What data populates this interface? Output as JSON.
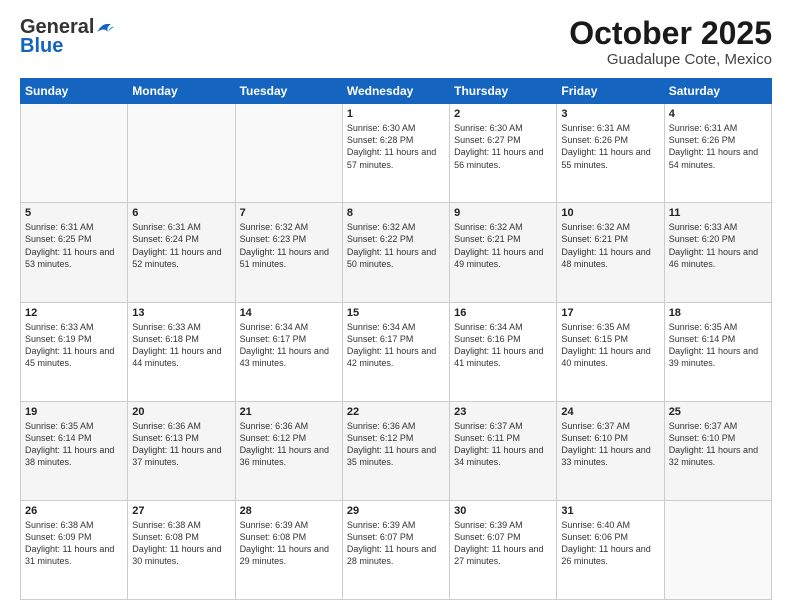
{
  "header": {
    "logo_general": "General",
    "logo_blue": "Blue",
    "title": "October 2025",
    "subtitle": "Guadalupe Cote, Mexico"
  },
  "weekdays": [
    "Sunday",
    "Monday",
    "Tuesday",
    "Wednesday",
    "Thursday",
    "Friday",
    "Saturday"
  ],
  "weeks": [
    [
      {
        "day": "",
        "sunrise": "",
        "sunset": "",
        "daylight": ""
      },
      {
        "day": "",
        "sunrise": "",
        "sunset": "",
        "daylight": ""
      },
      {
        "day": "",
        "sunrise": "",
        "sunset": "",
        "daylight": ""
      },
      {
        "day": "1",
        "sunrise": "Sunrise: 6:30 AM",
        "sunset": "Sunset: 6:28 PM",
        "daylight": "Daylight: 11 hours and 57 minutes."
      },
      {
        "day": "2",
        "sunrise": "Sunrise: 6:30 AM",
        "sunset": "Sunset: 6:27 PM",
        "daylight": "Daylight: 11 hours and 56 minutes."
      },
      {
        "day": "3",
        "sunrise": "Sunrise: 6:31 AM",
        "sunset": "Sunset: 6:26 PM",
        "daylight": "Daylight: 11 hours and 55 minutes."
      },
      {
        "day": "4",
        "sunrise": "Sunrise: 6:31 AM",
        "sunset": "Sunset: 6:26 PM",
        "daylight": "Daylight: 11 hours and 54 minutes."
      }
    ],
    [
      {
        "day": "5",
        "sunrise": "Sunrise: 6:31 AM",
        "sunset": "Sunset: 6:25 PM",
        "daylight": "Daylight: 11 hours and 53 minutes."
      },
      {
        "day": "6",
        "sunrise": "Sunrise: 6:31 AM",
        "sunset": "Sunset: 6:24 PM",
        "daylight": "Daylight: 11 hours and 52 minutes."
      },
      {
        "day": "7",
        "sunrise": "Sunrise: 6:32 AM",
        "sunset": "Sunset: 6:23 PM",
        "daylight": "Daylight: 11 hours and 51 minutes."
      },
      {
        "day": "8",
        "sunrise": "Sunrise: 6:32 AM",
        "sunset": "Sunset: 6:22 PM",
        "daylight": "Daylight: 11 hours and 50 minutes."
      },
      {
        "day": "9",
        "sunrise": "Sunrise: 6:32 AM",
        "sunset": "Sunset: 6:21 PM",
        "daylight": "Daylight: 11 hours and 49 minutes."
      },
      {
        "day": "10",
        "sunrise": "Sunrise: 6:32 AM",
        "sunset": "Sunset: 6:21 PM",
        "daylight": "Daylight: 11 hours and 48 minutes."
      },
      {
        "day": "11",
        "sunrise": "Sunrise: 6:33 AM",
        "sunset": "Sunset: 6:20 PM",
        "daylight": "Daylight: 11 hours and 46 minutes."
      }
    ],
    [
      {
        "day": "12",
        "sunrise": "Sunrise: 6:33 AM",
        "sunset": "Sunset: 6:19 PM",
        "daylight": "Daylight: 11 hours and 45 minutes."
      },
      {
        "day": "13",
        "sunrise": "Sunrise: 6:33 AM",
        "sunset": "Sunset: 6:18 PM",
        "daylight": "Daylight: 11 hours and 44 minutes."
      },
      {
        "day": "14",
        "sunrise": "Sunrise: 6:34 AM",
        "sunset": "Sunset: 6:17 PM",
        "daylight": "Daylight: 11 hours and 43 minutes."
      },
      {
        "day": "15",
        "sunrise": "Sunrise: 6:34 AM",
        "sunset": "Sunset: 6:17 PM",
        "daylight": "Daylight: 11 hours and 42 minutes."
      },
      {
        "day": "16",
        "sunrise": "Sunrise: 6:34 AM",
        "sunset": "Sunset: 6:16 PM",
        "daylight": "Daylight: 11 hours and 41 minutes."
      },
      {
        "day": "17",
        "sunrise": "Sunrise: 6:35 AM",
        "sunset": "Sunset: 6:15 PM",
        "daylight": "Daylight: 11 hours and 40 minutes."
      },
      {
        "day": "18",
        "sunrise": "Sunrise: 6:35 AM",
        "sunset": "Sunset: 6:14 PM",
        "daylight": "Daylight: 11 hours and 39 minutes."
      }
    ],
    [
      {
        "day": "19",
        "sunrise": "Sunrise: 6:35 AM",
        "sunset": "Sunset: 6:14 PM",
        "daylight": "Daylight: 11 hours and 38 minutes."
      },
      {
        "day": "20",
        "sunrise": "Sunrise: 6:36 AM",
        "sunset": "Sunset: 6:13 PM",
        "daylight": "Daylight: 11 hours and 37 minutes."
      },
      {
        "day": "21",
        "sunrise": "Sunrise: 6:36 AM",
        "sunset": "Sunset: 6:12 PM",
        "daylight": "Daylight: 11 hours and 36 minutes."
      },
      {
        "day": "22",
        "sunrise": "Sunrise: 6:36 AM",
        "sunset": "Sunset: 6:12 PM",
        "daylight": "Daylight: 11 hours and 35 minutes."
      },
      {
        "day": "23",
        "sunrise": "Sunrise: 6:37 AM",
        "sunset": "Sunset: 6:11 PM",
        "daylight": "Daylight: 11 hours and 34 minutes."
      },
      {
        "day": "24",
        "sunrise": "Sunrise: 6:37 AM",
        "sunset": "Sunset: 6:10 PM",
        "daylight": "Daylight: 11 hours and 33 minutes."
      },
      {
        "day": "25",
        "sunrise": "Sunrise: 6:37 AM",
        "sunset": "Sunset: 6:10 PM",
        "daylight": "Daylight: 11 hours and 32 minutes."
      }
    ],
    [
      {
        "day": "26",
        "sunrise": "Sunrise: 6:38 AM",
        "sunset": "Sunset: 6:09 PM",
        "daylight": "Daylight: 11 hours and 31 minutes."
      },
      {
        "day": "27",
        "sunrise": "Sunrise: 6:38 AM",
        "sunset": "Sunset: 6:08 PM",
        "daylight": "Daylight: 11 hours and 30 minutes."
      },
      {
        "day": "28",
        "sunrise": "Sunrise: 6:39 AM",
        "sunset": "Sunset: 6:08 PM",
        "daylight": "Daylight: 11 hours and 29 minutes."
      },
      {
        "day": "29",
        "sunrise": "Sunrise: 6:39 AM",
        "sunset": "Sunset: 6:07 PM",
        "daylight": "Daylight: 11 hours and 28 minutes."
      },
      {
        "day": "30",
        "sunrise": "Sunrise: 6:39 AM",
        "sunset": "Sunset: 6:07 PM",
        "daylight": "Daylight: 11 hours and 27 minutes."
      },
      {
        "day": "31",
        "sunrise": "Sunrise: 6:40 AM",
        "sunset": "Sunset: 6:06 PM",
        "daylight": "Daylight: 11 hours and 26 minutes."
      },
      {
        "day": "",
        "sunrise": "",
        "sunset": "",
        "daylight": ""
      }
    ]
  ]
}
